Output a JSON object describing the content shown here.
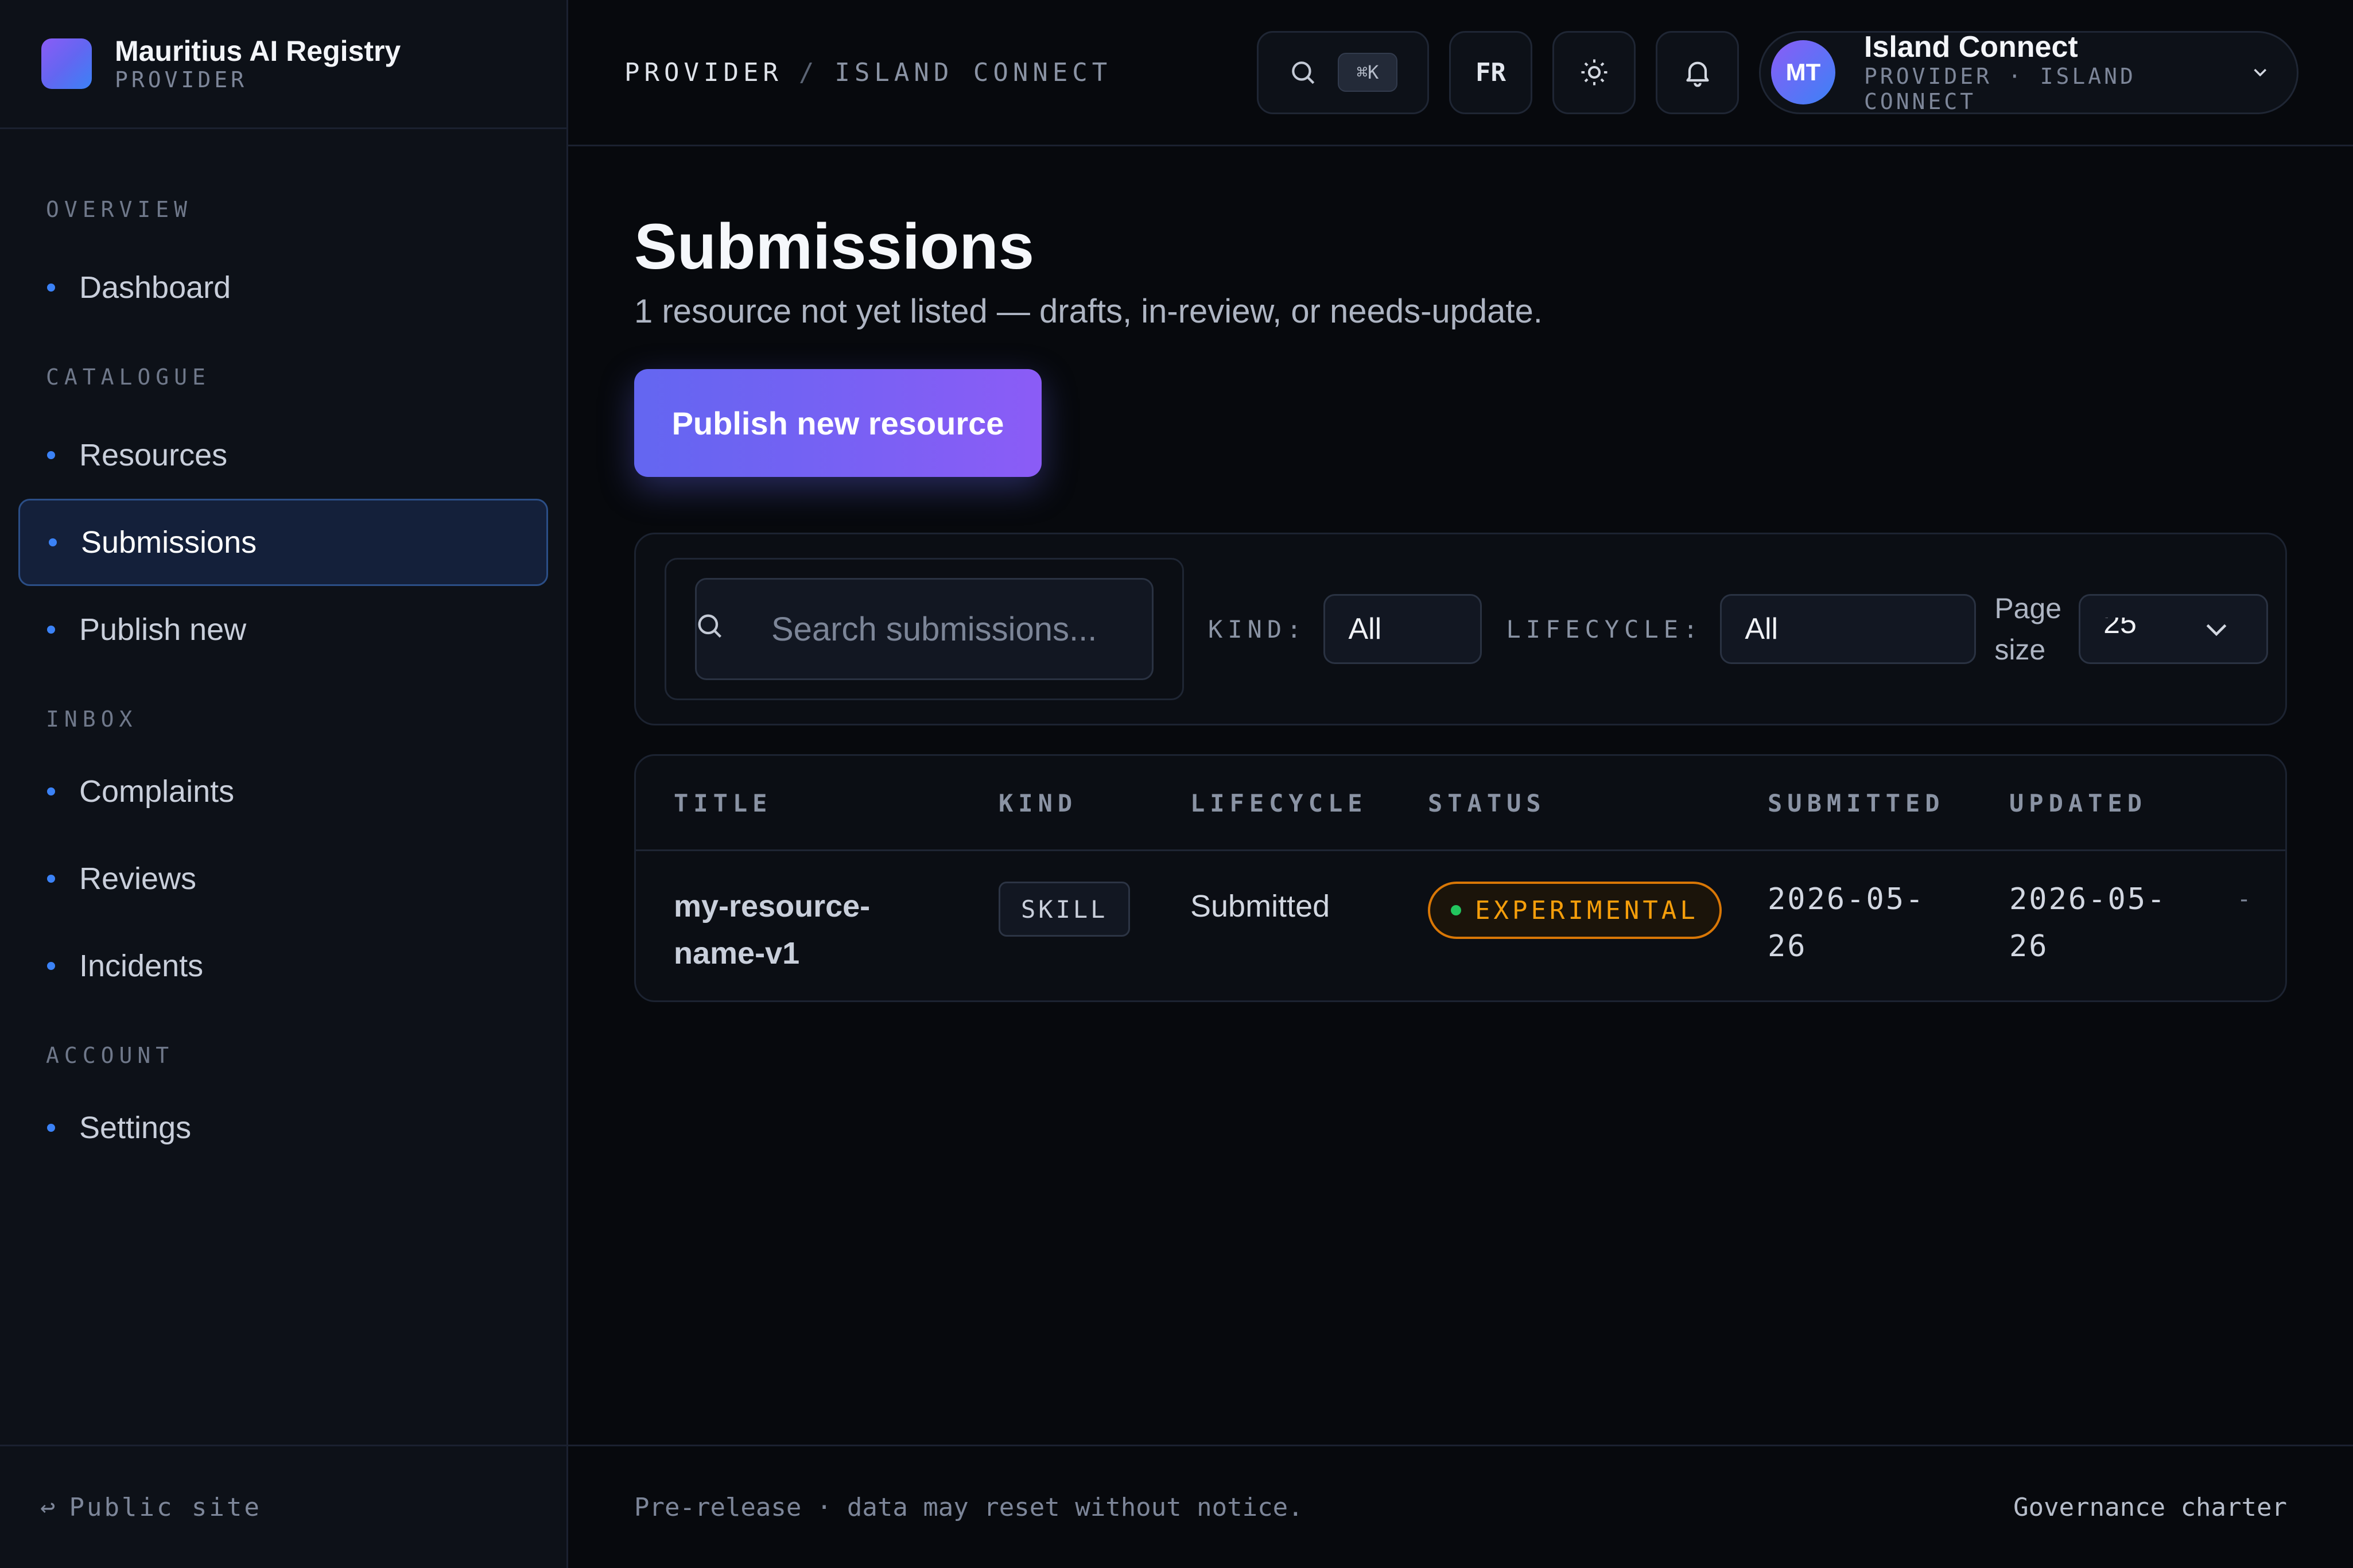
{
  "brand": {
    "title": "Mauritius AI Registry",
    "subtitle": "PROVIDER"
  },
  "sidebar": {
    "sections": [
      {
        "label": "OVERVIEW",
        "items": [
          {
            "label": "Dashboard"
          }
        ]
      },
      {
        "label": "CATALOGUE",
        "items": [
          {
            "label": "Resources"
          },
          {
            "label": "Submissions",
            "active": true
          },
          {
            "label": "Publish new"
          }
        ]
      },
      {
        "label": "INBOX",
        "items": [
          {
            "label": "Complaints"
          },
          {
            "label": "Reviews"
          },
          {
            "label": "Incidents"
          }
        ]
      },
      {
        "label": "ACCOUNT",
        "items": [
          {
            "label": "Settings"
          }
        ]
      }
    ],
    "footer": {
      "arrow": "↩",
      "label": "Public site"
    }
  },
  "topbar": {
    "breadcrumb": {
      "first": "PROVIDER",
      "separator": "/",
      "second": "ISLAND CONNECT"
    },
    "search_shortcut": "⌘K",
    "language": "FR",
    "user": {
      "initials": "MT",
      "name": "Island Connect",
      "subtitle": "PROVIDER · ISLAND CONNECT"
    }
  },
  "main": {
    "title": "Submissions",
    "subtitle": "1 resource not yet listed — drafts, in-review, or needs-update.",
    "publish_label": "Publish new resource",
    "filters": {
      "search_placeholder": "Search submissions...",
      "kind_label": "KIND:",
      "kind_value": "All",
      "lifecycle_label": "LIFECYCLE:",
      "lifecycle_value": "All",
      "page_size_label_1": "Page",
      "page_size_label_2": "size",
      "page_size_value": "25"
    },
    "table": {
      "columns": [
        "TITLE",
        "KIND",
        "LIFECYCLE",
        "STATUS",
        "SUBMITTED",
        "UPDATED"
      ],
      "rows": [
        {
          "title_1": "my-resource-",
          "title_2": "name-v1",
          "kind": "SKILL",
          "lifecycle": "Submitted",
          "status": "EXPERIMENTAL",
          "submitted_1": "2026-05-",
          "submitted_2": "26",
          "updated_1": "2026-05-",
          "updated_2": "26",
          "extra": "-"
        }
      ]
    }
  },
  "footer": {
    "notice": "Pre-release · data may reset without notice.",
    "link": "Governance charter"
  },
  "colors": {
    "accent": "#6366f1",
    "accent_2": "#8b5cf6",
    "status_experimental": "#f59e0b",
    "dot_green": "#22c55e",
    "nav_dot": "#3b82f6"
  }
}
